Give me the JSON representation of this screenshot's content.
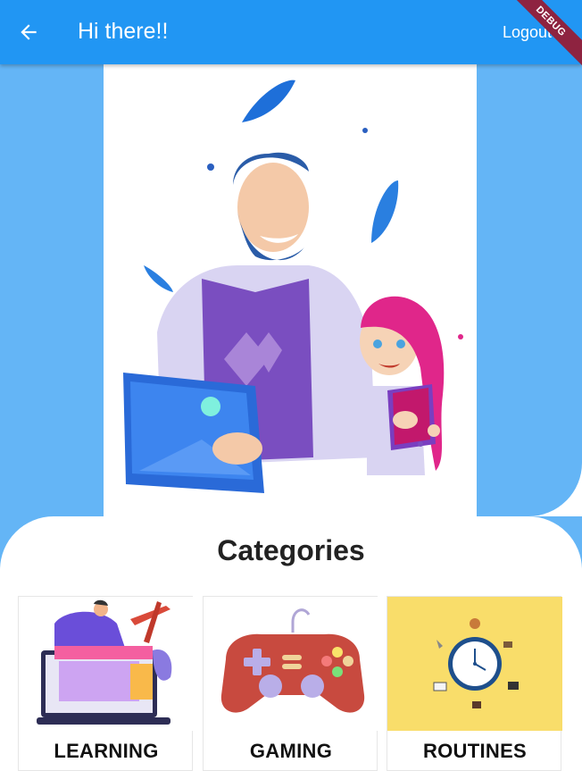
{
  "appbar": {
    "title": "Hi there!!",
    "logout_label": "Logout",
    "debug_label": "DEBUG",
    "color": "#2196f3"
  },
  "page": {
    "background": "#64b5f6"
  },
  "hero": {
    "image": "teacher-and-student-illustration"
  },
  "section": {
    "title": "Categories"
  },
  "categories": [
    {
      "label": "LEARNING",
      "image": "learning-illustration"
    },
    {
      "label": "GAMING",
      "image": "game-controller-illustration"
    },
    {
      "label": "ROUTINES",
      "image": "clock-routine-illustration"
    }
  ]
}
